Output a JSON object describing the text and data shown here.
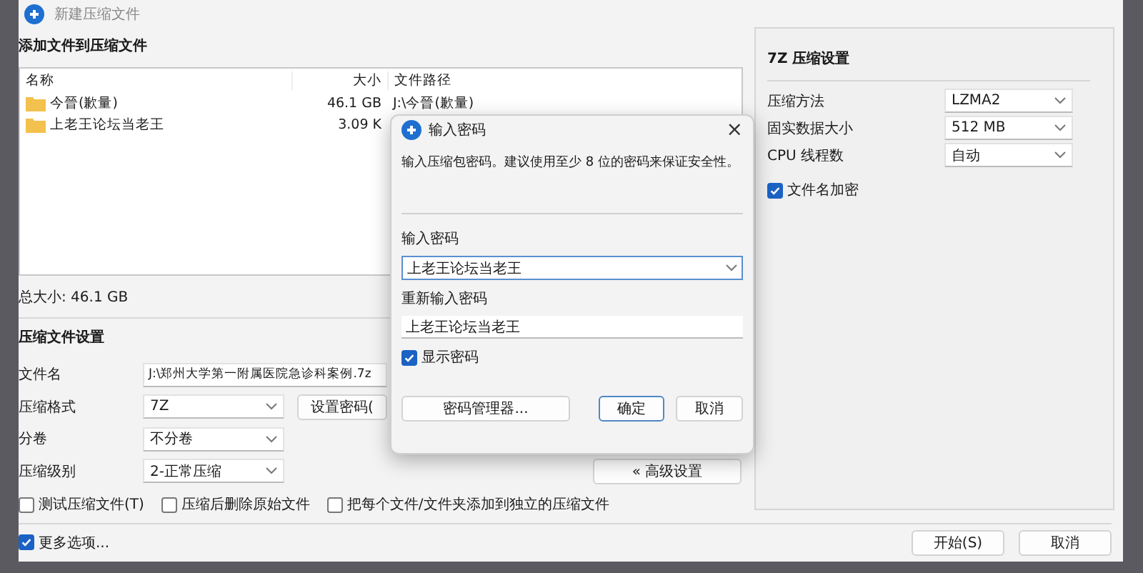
{
  "window": {
    "title": "新建压缩文件"
  },
  "files": {
    "heading": "添加文件到压缩文件",
    "columns": [
      "名称",
      "大小",
      "文件路径"
    ],
    "rows": [
      {
        "name": "今晉(歉量)",
        "size": "46.1 GB",
        "path": "J:\\今晉(歉量)"
      },
      {
        "name": "上老王论坛当老王",
        "size": "3.09 K",
        "path": ""
      }
    ],
    "total": "总大小: 46.1 GB"
  },
  "settings": {
    "heading": "压缩文件设置",
    "fields": [
      {
        "kind": "input",
        "label": "文件名",
        "value": "J:\\郑州大学第一附属医院急诊科案例.7z"
      },
      {
        "kind": "select",
        "label": "压缩格式",
        "value": "7Z",
        "button": "设置密码("
      },
      {
        "kind": "select",
        "label": "分卷",
        "value": "不分卷"
      },
      {
        "kind": "select",
        "label": "压缩级别",
        "value": "2-正常压缩",
        "button": "« 高级设置"
      }
    ],
    "options": [
      {
        "label": "测试压缩文件(T)",
        "checked": false
      },
      {
        "label": "压缩后删除原始文件",
        "checked": false
      },
      {
        "label": "把每个文件/文件夹添加到独立的压缩文件",
        "checked": false
      }
    ]
  },
  "more": {
    "label": "更多选项...",
    "checked": true
  },
  "buttons": [
    "开始(S)",
    "取消"
  ],
  "seven_zip": {
    "heading": "7Z 压缩设置",
    "rows": [
      {
        "label": "压缩方法",
        "value": "LZMA2"
      },
      {
        "label": "固实数据大小",
        "value": "512 MB"
      },
      {
        "label": "CPU 线程数",
        "value": "自动"
      }
    ],
    "encrypt_names": {
      "label": "文件名加密",
      "checked": true
    }
  },
  "dialog": {
    "title": "输入密码",
    "close": "×",
    "hint": "输入压缩包密码。建议使用至少 8 位的密码来保证安全性。",
    "password_label": "输入密码",
    "password": "上老王论坛当老王",
    "repeat_label": "重新输入密码",
    "repeat": "上老王论坛当老王",
    "show": {
      "label": "显示密码",
      "checked": true
    },
    "manager": "密码管理器...",
    "ok": "确定",
    "cancel": "取消"
  }
}
